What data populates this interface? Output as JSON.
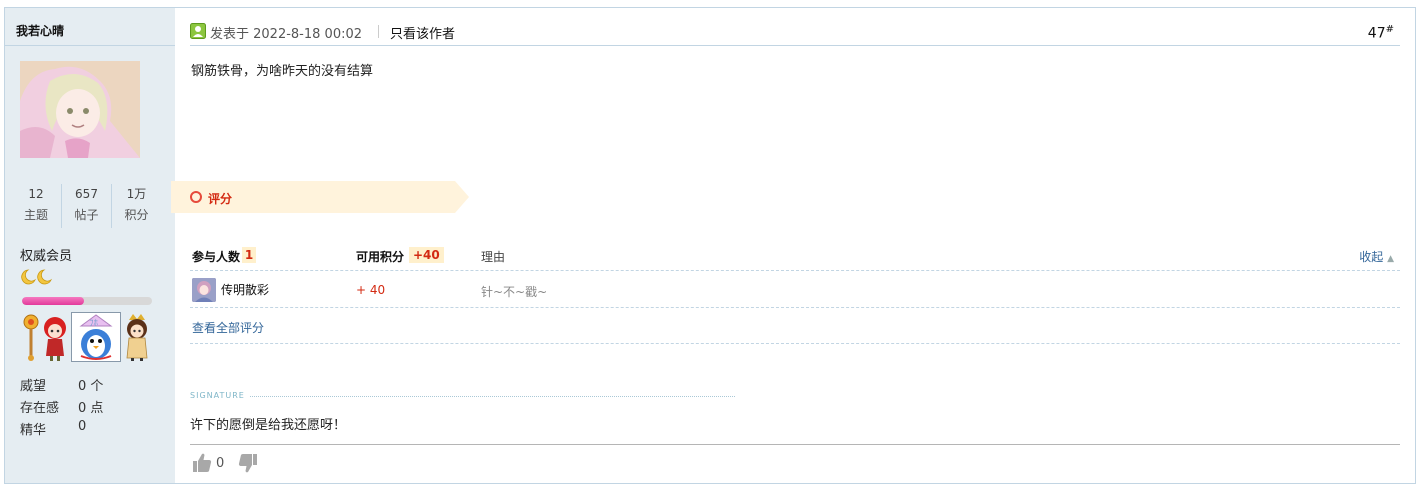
{
  "author": {
    "name": "我若心晴",
    "stats": [
      {
        "value": "12",
        "label": "主题"
      },
      {
        "value": "657",
        "label": "帖子"
      },
      {
        "value": "1万",
        "label": "积分"
      }
    ],
    "rank": "权威会员",
    "level_progress": 0.48,
    "attributes": [
      {
        "key": "威望",
        "value": "0 个"
      },
      {
        "key": "存在感",
        "value": "0 点"
      },
      {
        "key": "精华",
        "value": "0"
      }
    ]
  },
  "post": {
    "time": "发表于 2022-8-18 00:02",
    "only_author": "只看该作者",
    "floor": "47",
    "floor_suffix": "#",
    "content": "钢筋铁骨，为啥昨天的没有结算"
  },
  "rating": {
    "tab_label": "评分",
    "participants_label": "参与人数",
    "participants_count": "1",
    "score_label": "可用积分",
    "score_total": "+40",
    "reason_label": "理由",
    "collapse_label": "收起",
    "rows": [
      {
        "user": "传明散彩",
        "score": "+ 40",
        "reason": "针~不~戳~"
      }
    ],
    "view_all": "查看全部评分"
  },
  "signature": {
    "label": "SIGNATURE",
    "text": "许下的愿倒是给我还愿呀！"
  },
  "footer": {
    "like_count": "0"
  },
  "colors": {
    "sidebar_bg": "#e5edf2",
    "accent_red": "#d32a12",
    "link": "#336699",
    "rate_tab_bg": "#fff3dc"
  }
}
